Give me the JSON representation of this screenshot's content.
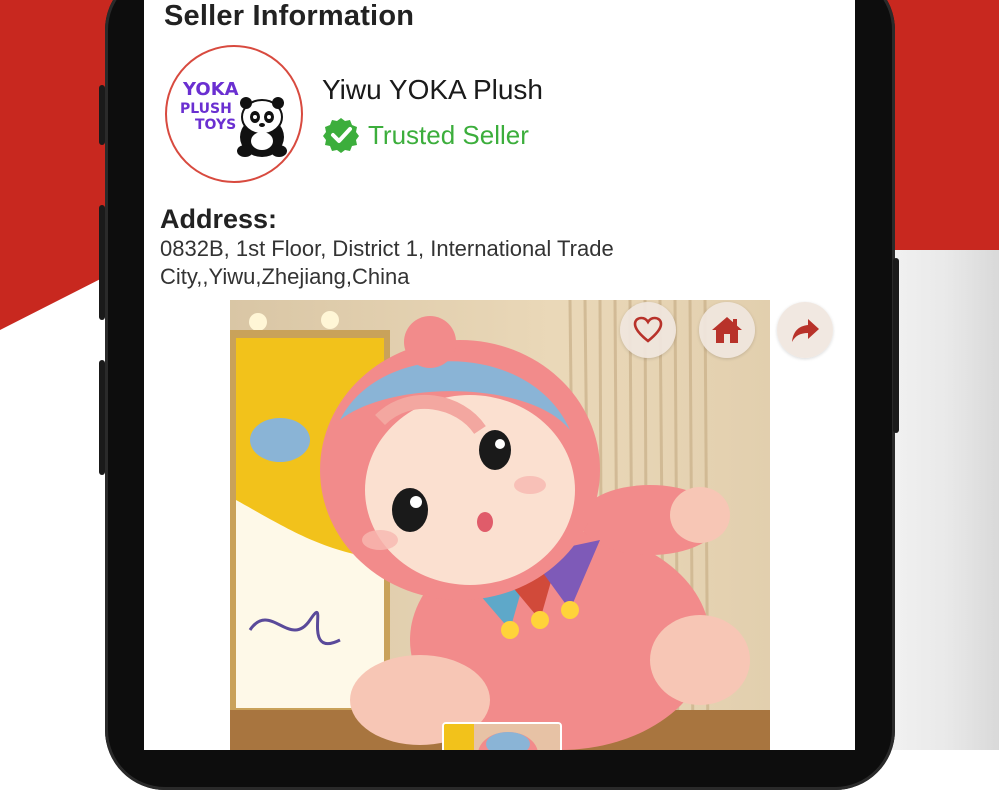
{
  "seller_section": {
    "title": "Seller Information",
    "logo_text": [
      "YOKA",
      "PLUSH",
      "TOYS"
    ],
    "name": "Yiwu YOKA Plush",
    "badge": "Trusted Seller",
    "address_label": "Address:",
    "address_line1": "0832B, 1st Floor, District 1, International Trade",
    "address_line2": "City,,Yiwu,Zhejiang,China"
  },
  "actions": [
    {
      "icon": "heart-icon"
    },
    {
      "icon": "home-icon"
    },
    {
      "icon": "share-icon"
    }
  ],
  "colors": {
    "brand_red": "#c8281f",
    "trusted_green": "#3cae3c",
    "icon_red": "#b8322a"
  }
}
